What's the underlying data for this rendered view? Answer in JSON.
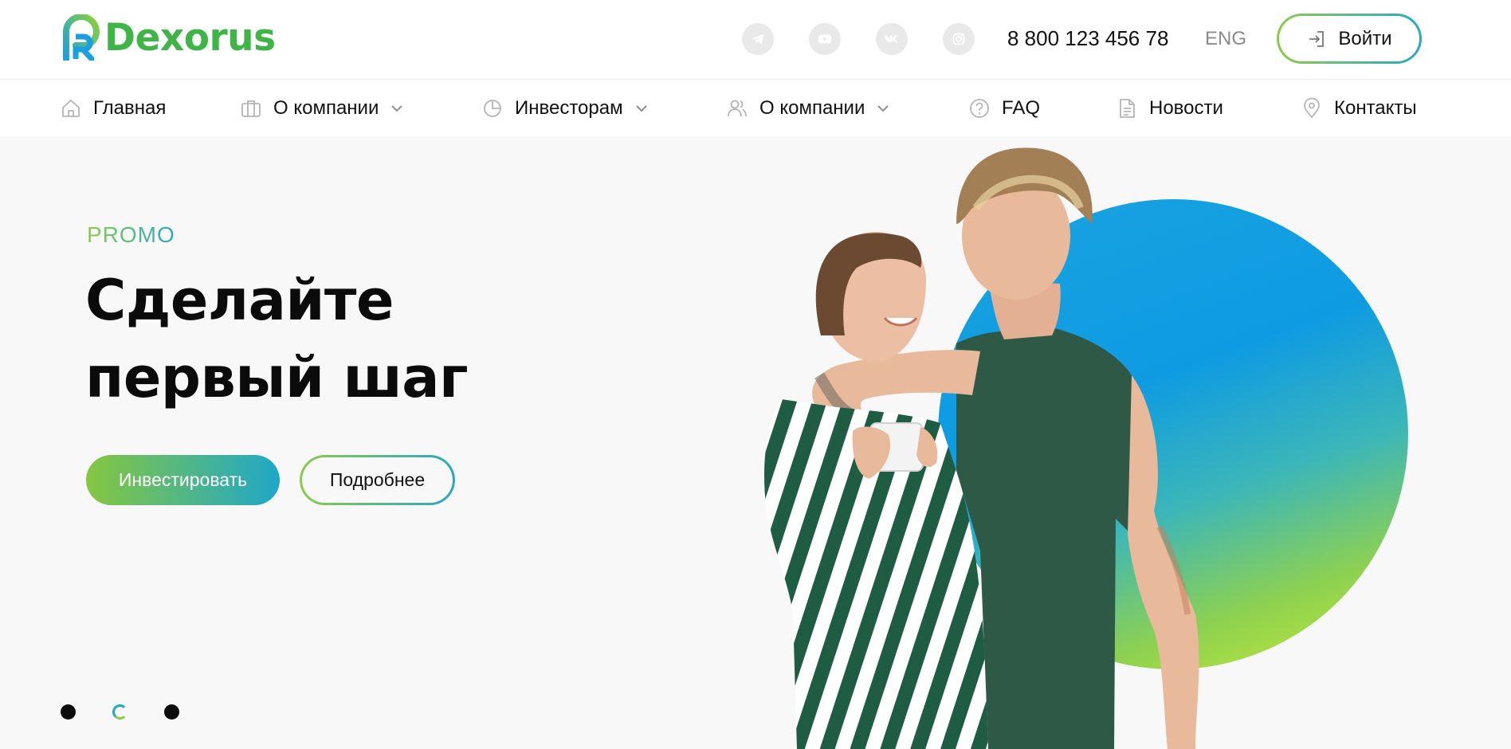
{
  "header": {
    "logo_text": "Dexorus",
    "socials": [
      "telegram-icon",
      "youtube-icon",
      "vk-icon",
      "instagram-icon"
    ],
    "phone": "8 800 123 456 78",
    "lang": "ENG",
    "login_label": "Войти"
  },
  "nav": {
    "items": [
      {
        "label": "Главная",
        "icon": "home-icon"
      },
      {
        "label": "О компании",
        "icon": "briefcase-icon"
      },
      {
        "label": "Инвесторам",
        "icon": "pie-chart-icon"
      },
      {
        "label": "О компании",
        "icon": "users-icon"
      },
      {
        "label": "FAQ",
        "icon": "question-icon"
      },
      {
        "label": "Новости",
        "icon": "document-icon"
      },
      {
        "label": "Контакты",
        "icon": "location-pin-icon"
      }
    ]
  },
  "hero": {
    "eyebrow": "PROMO",
    "title_line1": "Сделайте",
    "title_line2": "первый шаг",
    "invest_label": "Инвестировать",
    "more_label": "Подробнее",
    "slides_count": 3,
    "active_slide": 2
  },
  "colors": {
    "brand_green": "#3fb548",
    "gradient_start": "#8bcb4a",
    "gradient_end": "#29a8c4",
    "circle_blue": "#1aa3e0",
    "shirt_green": "#2f5a46"
  }
}
